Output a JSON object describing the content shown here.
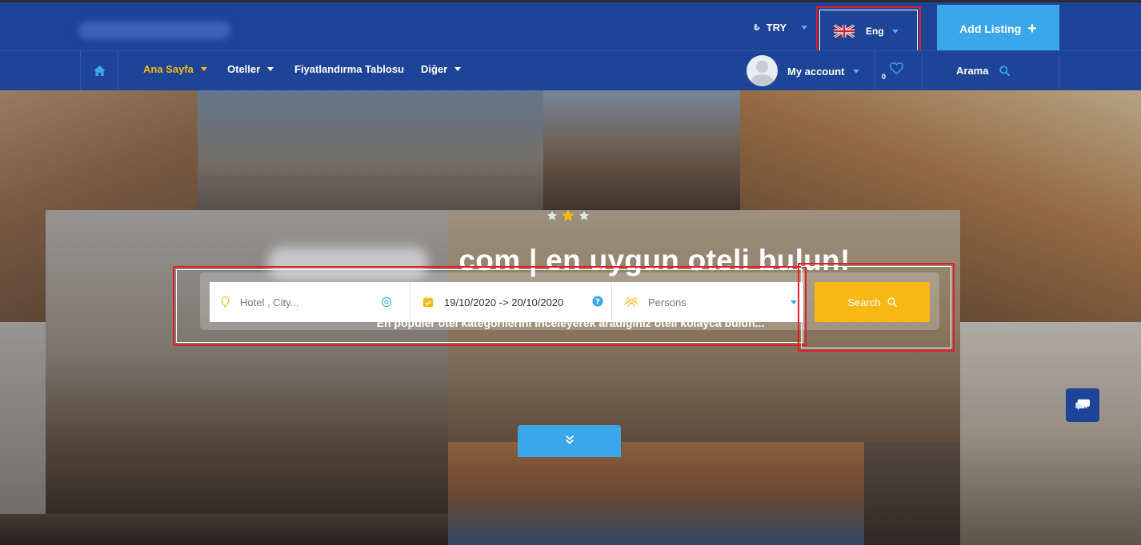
{
  "topbar": {
    "currency_symbol": "₺",
    "currency": "TRY",
    "language": "Eng",
    "add_listing": "Add Listing"
  },
  "nav": {
    "items": [
      {
        "label": "Ana Sayfa",
        "active": true
      },
      {
        "label": "Oteller"
      },
      {
        "label": "Fiyatlandırma Tablosu"
      },
      {
        "label": "Diğer"
      }
    ],
    "account": "My account",
    "wishlist_count": "0",
    "search_label": "Arama"
  },
  "hero": {
    "headline": "com | en uygun oteli bulun!",
    "subtitle": "En popüler otel kategorilerini inceleyerek aradığınız oteli kolayca bulun...",
    "rating_stars": 3
  },
  "search": {
    "location_placeholder": "Hotel , City...",
    "dates": "19/10/2020 -> 20/10/2020",
    "persons_placeholder": "Persons",
    "button": "Search"
  },
  "colors": {
    "navy": "#1d4496",
    "accent_blue": "#3aa7ea",
    "accent_yellow": "#f5b815",
    "highlight_red": "#e21d25"
  },
  "icons": [
    "home-icon",
    "heart-icon",
    "search-icon",
    "location-pin-icon",
    "target-icon",
    "calendar-icon",
    "help-icon",
    "people-icon",
    "chevron-double-down-icon",
    "chat-icon",
    "uk-flag-icon"
  ]
}
